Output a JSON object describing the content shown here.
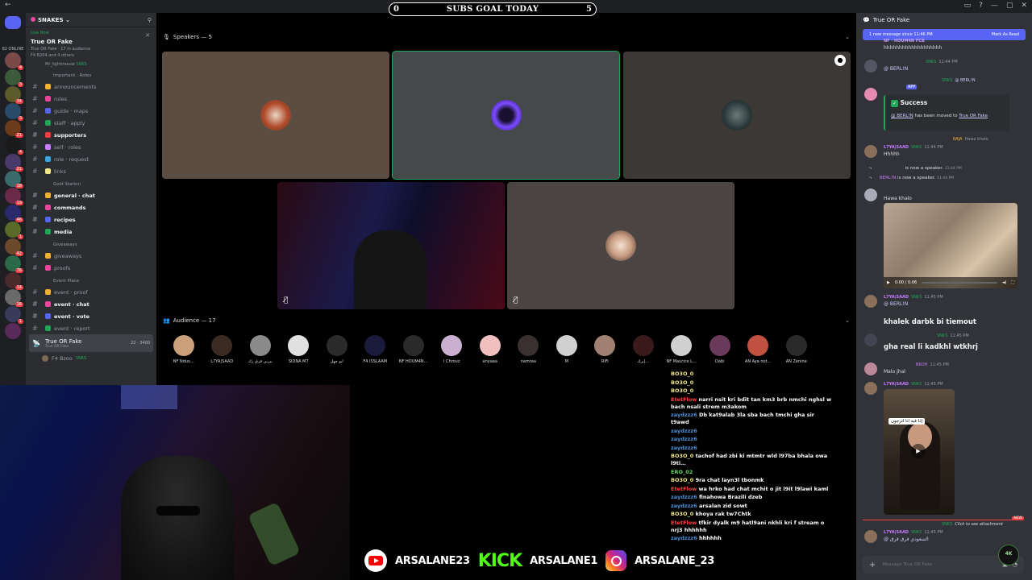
{
  "window": {
    "back": "←",
    "controls": [
      "▭",
      "?",
      "—",
      "▢",
      "✕"
    ]
  },
  "goal": {
    "left": "0",
    "title": "SUBS GOAL TODAY",
    "right": "5"
  },
  "rail": {
    "online": "82 ONLINE",
    "badges": [
      "4",
      "3",
      "34",
      "3",
      "21",
      "4",
      "21",
      "18",
      "19",
      "46",
      "1",
      "42",
      "76",
      "14",
      "16",
      "1"
    ]
  },
  "sidebar": {
    "server_name": "SNAKES",
    "live": {
      "tag": "Live Now",
      "title": "True OR Fake",
      "sub1": "True OR Fake · 17 in audience",
      "sub2": "F4 B204 and 4 others",
      "user": "Mr_lightmouse",
      "user_tag": "SNKS"
    },
    "cat_important": "Important · Roles",
    "channels_1": [
      "announcements",
      "rules",
      "guide · maps",
      "staff · apply",
      "supporters",
      "self · roles",
      "role · request",
      "links"
    ],
    "cat_gold": "Gold Station",
    "channels_2": [
      "general · chat",
      "commands",
      "recipes",
      "media"
    ],
    "cat_giveaways": "Giveaways",
    "channels_3": [
      "giveaways",
      "proofs"
    ],
    "cat_event": "Event Place",
    "channels_4": [
      "event · proof",
      "event · chat",
      "event · vote",
      "event · report"
    ],
    "active_stage": {
      "name": "True OR Fake",
      "sub": "True OR Fake",
      "count_a": "22",
      "count_b": "3400"
    },
    "user_row": "F4 Bzoo",
    "user_tag": "SNKS"
  },
  "stage": {
    "speakers_header": "Speakers — 5",
    "audience_header": "Audience — 17",
    "audience": [
      "NF Ndus…",
      "L7YA|SAAD",
      "نيرني قرق زك",
      "SIDNA M7",
      "أبو جهل",
      "F4 ISSLAAM",
      "NF HOUM4N…",
      "l Chrouz",
      "anyaaa",
      "namraa",
      "M",
      "RiFi",
      "إيرك…",
      "NF Maurice L…",
      "Dabi",
      "AN Aya not…",
      "AN Zenine"
    ]
  },
  "chat": {
    "channel": "True OR Fake",
    "new_banner": "1 new message since 11:46 PM",
    "mark_read": "Mark As Read",
    "messages": [
      {
        "name": "NF · HOUM4N FCB",
        "text": "hhhhhhhhhhhhhhhhhhh"
      },
      {
        "name": "SNKS",
        "time": "11:44 PM",
        "text": "@ BERL!N"
      },
      {
        "name": "SNKS",
        "text": "@ BERL!N",
        "app": "APP"
      },
      {
        "name": "SNKS",
        "text": "Hawa khalo",
        "badge": "RAJA"
      },
      {
        "name": "L7YA|SAAD",
        "tag": "SNKS",
        "time": "11:44 PM",
        "text": "Hhhhh"
      },
      {
        "name": "L7YA|SAAD",
        "tag": "SNKS",
        "time": "11:45 PM",
        "text": "@ BERL!N"
      },
      {
        "name": "",
        "tag": "SNKS",
        "time": "11:45 PM",
        "text": "gha real li kadkhl wtkhrj"
      },
      {
        "name": "",
        "tag": "BRDH",
        "time": "11:45 PM",
        "text": "Malo jhal"
      },
      {
        "name": "L7YA|SAAD",
        "tag": "SNKS",
        "time": "11:45 PM"
      },
      {
        "name": "L7YA|SAAD",
        "tag": "SNKS",
        "time": "11:45 PM",
        "text": "@ السعودي فرق قرق"
      }
    ],
    "success_title": "Success",
    "success_desc_a": "@ BERL!N",
    "success_desc_b": "has been moved to",
    "success_desc_c": "True OR Fake",
    "sys1_name": "",
    "sys1_text": "is now a speaker.",
    "sys1_time": "11:44 PM",
    "sys2_name": "BERL!N",
    "sys2_text": "is now a speaker.",
    "sys2_time": "11:44 PM",
    "speaker_msg_name": "Hawa khalo",
    "video_time": "0:00 / 0:06",
    "big_text": "khalek darbk bi tiemout",
    "video2_caption": "إذا فيه انا اترجون",
    "click_attach": "Click to see attachment",
    "new_label": "NEW",
    "input_placeholder": "Message True OR Fake",
    "logo": "4K"
  },
  "livechat": [
    {
      "user": "BO3O_0",
      "text": "",
      "color": "#f0e68c"
    },
    {
      "user": "BO3O_0",
      "text": "",
      "color": "#f0e68c"
    },
    {
      "user": "BO3O_0",
      "text": "",
      "color": "#f0e68c"
    },
    {
      "user": "EtetFlow",
      "text": "narri nsit kri bdit tan km3 brb nmchi nghsl w bach nsali strem m3akom",
      "color": "#ff4040"
    },
    {
      "user": "zaydzzz6",
      "text": "Db kat9alab 3la sba bach tmchi gha sir t9awd",
      "color": "#4a90d9"
    },
    {
      "user": "zaydzzz6",
      "text": "",
      "color": "#4a90d9"
    },
    {
      "user": "zaydzzz6",
      "text": "",
      "color": "#4a90d9"
    },
    {
      "user": "zaydzzz6",
      "text": "",
      "color": "#4a90d9"
    },
    {
      "user": "BO3O_0",
      "text": "tachof had zbi ki mtmtr wld l97ba bhala owa l9ti…",
      "color": "#f0e68c"
    },
    {
      "user": "ERO_02",
      "text": "",
      "color": "#5fd35f"
    },
    {
      "user": "BO3O_0",
      "text": "9ra chat layn3l tbonmk",
      "color": "#f0e68c"
    },
    {
      "user": "EtetFlow",
      "text": "wa hrko had chat mchit o jit l9it l9lawi kaml",
      "color": "#ff4040"
    },
    {
      "user": "zaydzzz6",
      "text": "finahowa Brazili dzeb",
      "color": "#4a90d9"
    },
    {
      "user": "zaydzzz6",
      "text": "arsalan zid sowt",
      "color": "#4a90d9"
    },
    {
      "user": "BO3O_0",
      "text": "khoya rak tw7Chtk",
      "color": "#f0e68c"
    },
    {
      "user": "EtetFlow",
      "text": "tfkir dyalk m9 hatl9ani nkhli kri f stream o nrj3 hhhhhh",
      "color": "#ff4040"
    },
    {
      "user": "zaydzzz6",
      "text": "hhhhhh",
      "color": "#4a90d9"
    }
  ],
  "socials": {
    "youtube": "ARSALANE23",
    "kick_logo": "KICK",
    "kick": "ARSALANE1",
    "instagram": "ARSALANE_23"
  }
}
